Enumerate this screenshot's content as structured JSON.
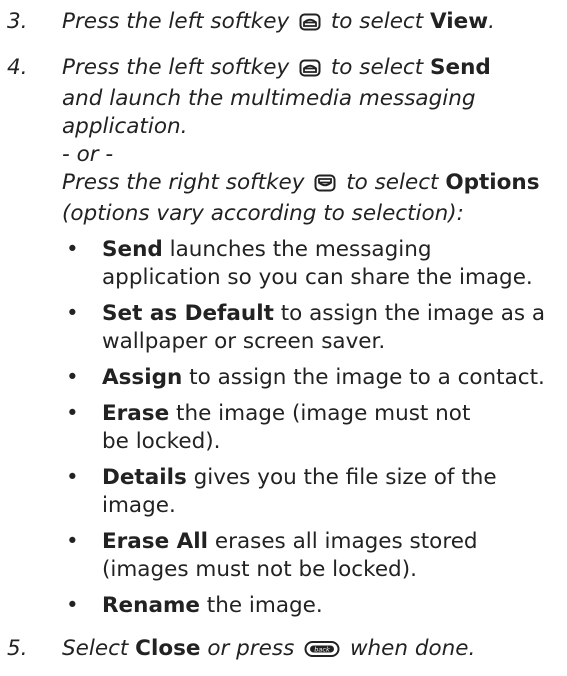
{
  "steps": [
    {
      "num": "3.",
      "text_before": "Press the left softkey",
      "text_after": "to select",
      "bold": "View",
      "tail": "."
    },
    {
      "num": "4.",
      "text_before": "Press the left softkey",
      "text_after": "to select",
      "bold": "Send",
      "line2": "and launch the multimedia messaging",
      "line3": "application.",
      "or": "- or -",
      "right_before": "Press the right softkey",
      "right_after": "to select",
      "right_bold": "Options",
      "right_note": "(options vary according to selection):",
      "options": [
        {
          "bold": "Send",
          "l1": "launches the messaging",
          "l2": "application so you can share the image."
        },
        {
          "bold": "Set as Default",
          "l1": "to assign the image as a",
          "l2": "wallpaper or screen saver."
        },
        {
          "bold": "Assign",
          "l1": "to assign the image to a contact.",
          "l2": ""
        },
        {
          "bold": "Erase",
          "l1": "the image (image must not",
          "l2": "be locked)."
        },
        {
          "bold": "Details",
          "l1": "gives you the file size of the",
          "l2": "image."
        },
        {
          "bold": "Erase All",
          "l1": "erases all images stored",
          "l2": "(images must not be locked)."
        },
        {
          "bold": "Rename",
          "l1": "the image.",
          "l2": ""
        }
      ]
    },
    {
      "num": "5.",
      "text_before": "Select",
      "bold": "Close",
      "text_mid": "or press",
      "key_label": "back",
      "tail": "when done."
    }
  ],
  "icons": {
    "left_softkey": "left-softkey-icon",
    "right_softkey": "right-softkey-icon",
    "back_key": "back-key-icon"
  }
}
